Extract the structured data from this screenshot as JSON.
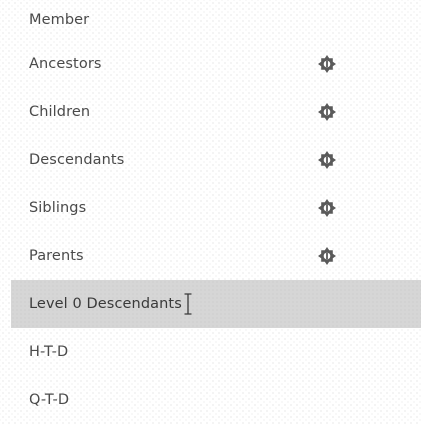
{
  "list": {
    "header": "Member",
    "items": [
      {
        "label": "Ancestors",
        "icon": "member-selection-icon"
      },
      {
        "label": "Children",
        "icon": "member-selection-icon"
      },
      {
        "label": "Descendants",
        "icon": "member-selection-icon"
      },
      {
        "label": "Siblings",
        "icon": "member-selection-icon"
      },
      {
        "label": "Parents",
        "icon": "member-selection-icon"
      },
      {
        "label": "Level 0 Descendants",
        "selected": true
      },
      {
        "label": "H-T-D"
      },
      {
        "label": "Q-T-D"
      }
    ]
  },
  "colors": {
    "text": "#4a4a4a",
    "selected_row": "#d6d6d6",
    "icon": "#5a5a5a"
  }
}
